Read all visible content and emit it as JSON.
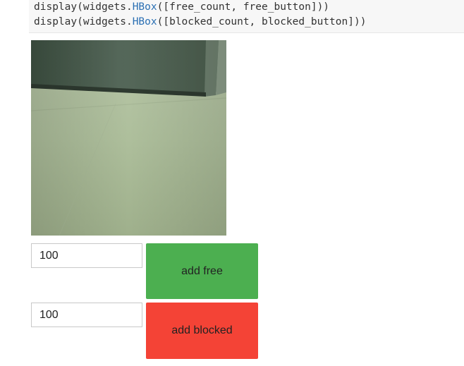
{
  "code": {
    "line1": {
      "prefix": "display(widgets.",
      "attr": "HBox",
      "suffix": "([free_count, free_button]))"
    },
    "line2": {
      "prefix": "display(widgets.",
      "attr": "HBox",
      "suffix": "([blocked_count, blocked_button]))"
    }
  },
  "free": {
    "count_value": "100",
    "button_label": "add free",
    "button_color": "#4caf50"
  },
  "blocked": {
    "count_value": "100",
    "button_label": "add blocked",
    "button_color": "#f44336"
  },
  "colors": {
    "code_background": "#f7f7f7",
    "code_attr": "#2a6fb3"
  }
}
